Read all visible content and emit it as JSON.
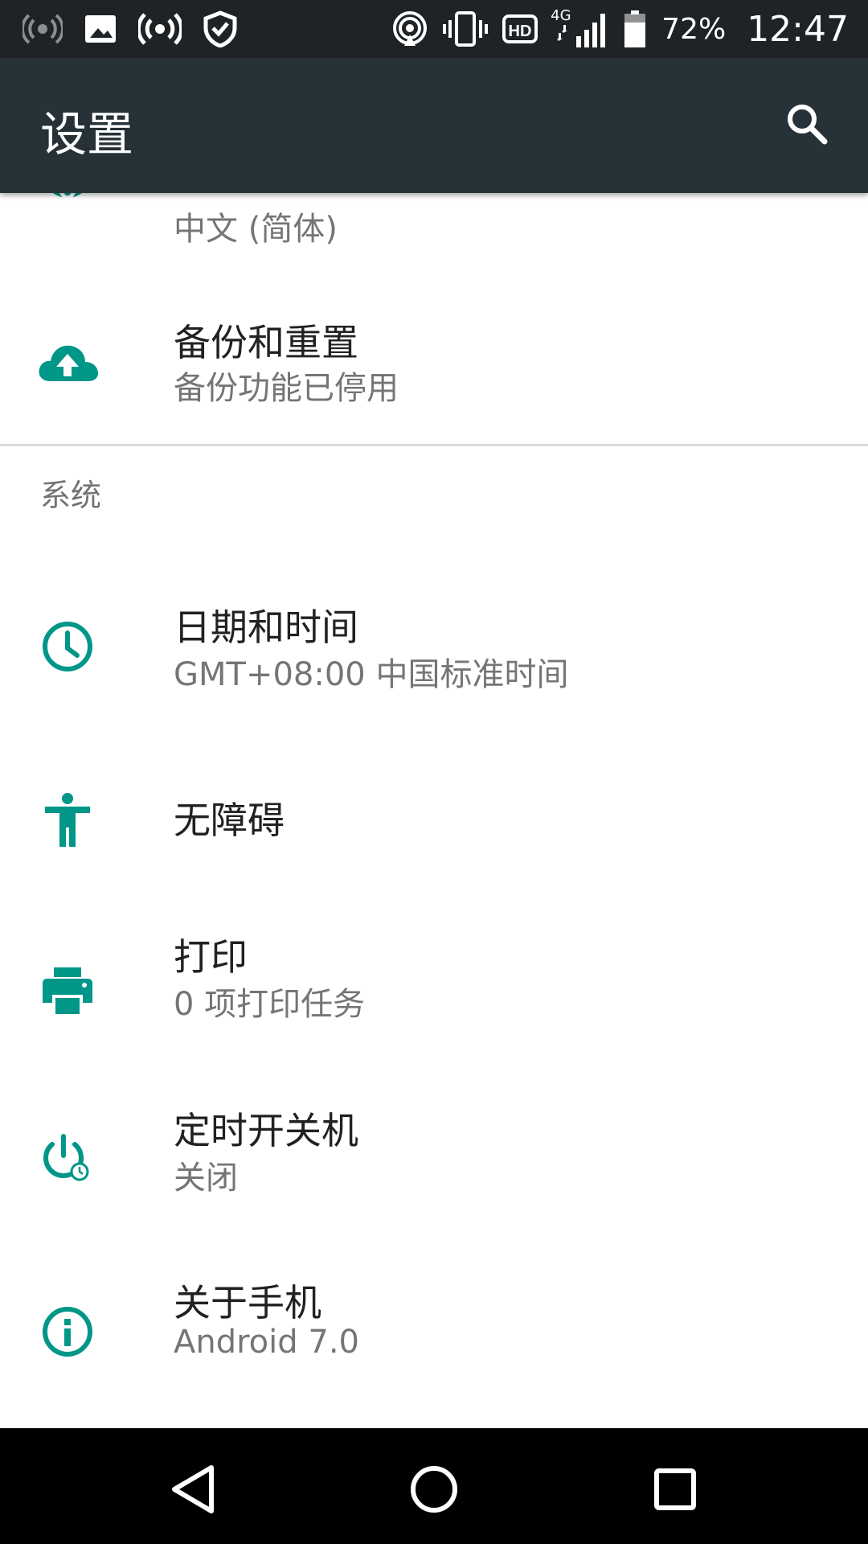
{
  "status_bar": {
    "battery_percent": "72%",
    "time": "12:47",
    "network_type": "4G",
    "hd_label": "HD",
    "icons": [
      "wifi-off-icon",
      "image-icon",
      "hotspot-icon",
      "shield-icon",
      "airplay-icon",
      "vibrate-icon",
      "hd-icon",
      "signal-icon",
      "battery-icon"
    ]
  },
  "app_bar": {
    "title": "设置",
    "search_icon": "search-icon"
  },
  "items_top": [
    {
      "icon": "language-icon",
      "title": "",
      "summary": "中文 (简体)"
    },
    {
      "icon": "cloud-upload-icon",
      "title": "备份和重置",
      "summary": "备份功能已停用"
    }
  ],
  "section": {
    "label": "系统"
  },
  "items_system": [
    {
      "icon": "clock-icon",
      "title": "日期和时间",
      "summary": "GMT+08:00 中国标准时间"
    },
    {
      "icon": "accessibility-icon",
      "title": "无障碍",
      "summary": ""
    },
    {
      "icon": "print-icon",
      "title": "打印",
      "summary": "0 项打印任务"
    },
    {
      "icon": "scheduled-power-icon",
      "title": "定时开关机",
      "summary": "关闭"
    },
    {
      "icon": "info-icon",
      "title": "关于手机",
      "summary": "Android 7.0"
    }
  ],
  "nav_bar": {
    "buttons": [
      "back-icon",
      "home-icon",
      "recents-icon"
    ]
  },
  "colors": {
    "status_bar_bg": "#1f2326",
    "app_bar_bg": "#263238",
    "accent": "#009688",
    "title_text": "#212121",
    "summary_text": "#757575"
  }
}
